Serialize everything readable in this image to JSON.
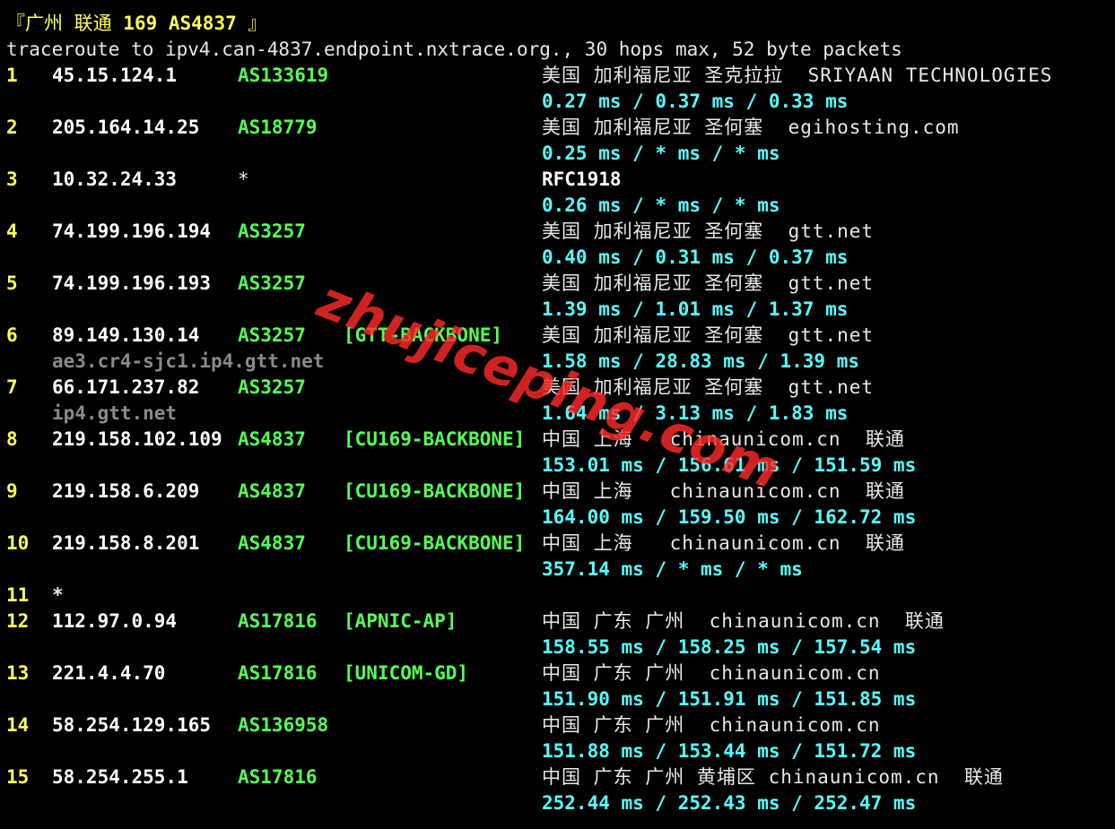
{
  "header": {
    "title_open": "『广州 联通 ",
    "title_bold": "169 AS4837",
    "title_close": " 』",
    "command": "traceroute to ipv4.can-4837.endpoint.nxtrace.org., 30 hops max, 52 byte packets"
  },
  "hops": [
    {
      "hop": "1",
      "ip": "45.15.124.1",
      "asn": "AS133619",
      "tag": "",
      "geo": "美国 加利福尼亚 圣克拉拉  SRIYAAN TECHNOLOGIES",
      "rdns": "",
      "rtt": "0.27 ms / 0.37 ms / 0.33 ms"
    },
    {
      "hop": "2",
      "ip": "205.164.14.25",
      "asn": "AS18779",
      "tag": "",
      "geo": "美国 加利福尼亚 圣何塞  egihosting.com",
      "rdns": "",
      "rtt": "0.25 ms / * ms / * ms"
    },
    {
      "hop": "3",
      "ip": "10.32.24.33",
      "asn": "*",
      "tag": "",
      "geo": "RFC1918",
      "rdns": "",
      "rtt": "0.26 ms / * ms / * ms"
    },
    {
      "hop": "4",
      "ip": "74.199.196.194",
      "asn": "AS3257",
      "tag": "",
      "geo": "美国 加利福尼亚 圣何塞  gtt.net",
      "rdns": "",
      "rtt": "0.40 ms / 0.31 ms / 0.37 ms"
    },
    {
      "hop": "5",
      "ip": "74.199.196.193",
      "asn": "AS3257",
      "tag": "",
      "geo": "美国 加利福尼亚 圣何塞  gtt.net",
      "rdns": "",
      "rtt": "1.39 ms / 1.01 ms / 1.37 ms"
    },
    {
      "hop": "6",
      "ip": "89.149.130.14",
      "asn": "AS3257",
      "tag": "[GTT-BACKBONE]",
      "geo": "美国 加利福尼亚 圣何塞  gtt.net",
      "rdns": "ae3.cr4-sjc1.ip4.gtt.net",
      "rtt": "1.58 ms / 28.83 ms / 1.39 ms"
    },
    {
      "hop": "7",
      "ip": "66.171.237.82",
      "asn": "AS3257",
      "tag": "",
      "geo": "美国 加利福尼亚 圣何塞  gtt.net",
      "rdns": "ip4.gtt.net",
      "rtt": "1.64 ms / 3.13 ms / 1.83 ms"
    },
    {
      "hop": "8",
      "ip": "219.158.102.109",
      "asn": "AS4837",
      "tag": "[CU169-BACKBONE]",
      "geo": "中国 上海   chinaunicom.cn  联通",
      "rdns": "",
      "rtt": "153.01 ms / 156.61 ms / 151.59 ms"
    },
    {
      "hop": "9",
      "ip": "219.158.6.209",
      "asn": "AS4837",
      "tag": "[CU169-BACKBONE]",
      "geo": "中国 上海   chinaunicom.cn  联通",
      "rdns": "",
      "rtt": "164.00 ms / 159.50 ms / 162.72 ms"
    },
    {
      "hop": "10",
      "ip": "219.158.8.201",
      "asn": "AS4837",
      "tag": "[CU169-BACKBONE]",
      "geo": "中国 上海   chinaunicom.cn  联通",
      "rdns": "",
      "rtt": "357.14 ms / * ms / * ms"
    },
    {
      "hop": "11",
      "ip": "*",
      "asn": "",
      "tag": "",
      "geo": "",
      "rdns": "",
      "rtt": ""
    },
    {
      "hop": "12",
      "ip": "112.97.0.94",
      "asn": "AS17816",
      "tag": "[APNIC-AP]",
      "geo": "中国 广东 广州  chinaunicom.cn  联通",
      "rdns": "",
      "rtt": "158.55 ms / 158.25 ms / 157.54 ms"
    },
    {
      "hop": "13",
      "ip": "221.4.4.70",
      "asn": "AS17816",
      "tag": "[UNICOM-GD]",
      "geo": "中国 广东 广州  chinaunicom.cn",
      "rdns": "",
      "rtt": "151.90 ms / 151.91 ms / 151.85 ms"
    },
    {
      "hop": "14",
      "ip": "58.254.129.165",
      "asn": "AS136958",
      "tag": "",
      "geo": "中国 广东 广州  chinaunicom.cn",
      "rdns": "",
      "rtt": "151.88 ms / 153.44 ms / 151.72 ms"
    },
    {
      "hop": "15",
      "ip": "58.254.255.1",
      "asn": "AS17816",
      "tag": "",
      "geo": "中国 广东 广州 黄埔区 chinaunicom.cn  联通",
      "rdns": "",
      "rtt": "252.44 ms / 252.43 ms / 252.47 ms"
    }
  ],
  "watermark": "zhujiceping.com",
  "colors": {
    "background": "#000000",
    "hop": "#ffff55",
    "ip": "#ffffff",
    "asn": "#55ff55",
    "rtt": "#55ffff",
    "rdns": "#8a8a8a",
    "watermark": "#ff2a2a"
  }
}
